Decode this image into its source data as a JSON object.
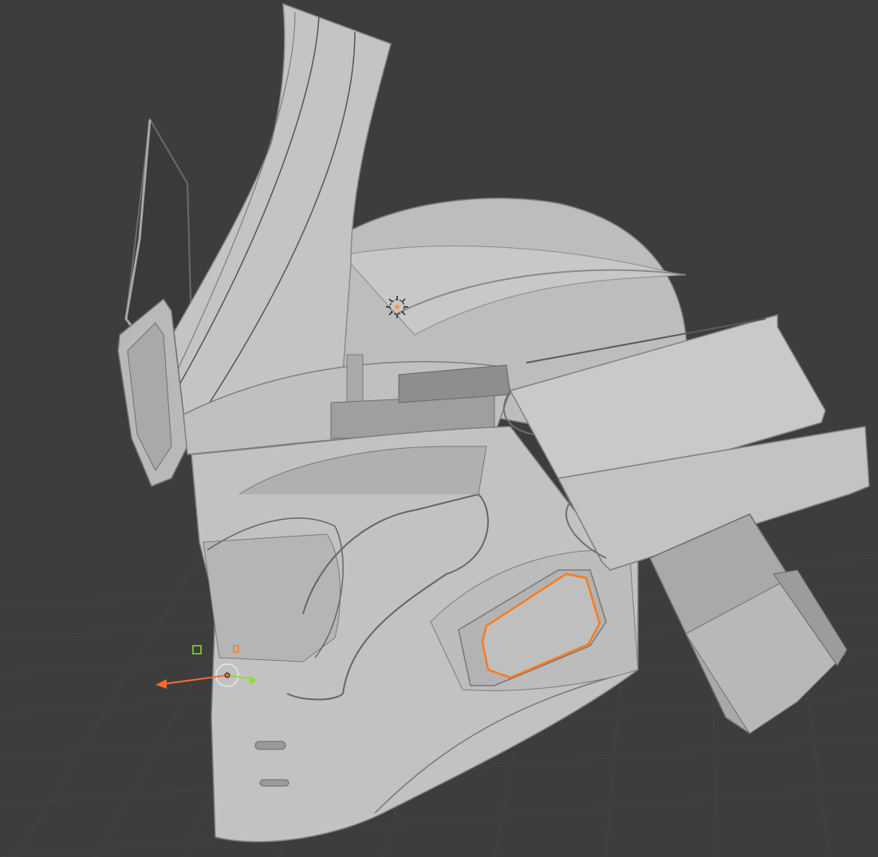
{
  "viewport": {
    "view": "3d-viewport",
    "background": "#3d3d3d",
    "grid_color": "#444444",
    "model_color": "#bfbfbf",
    "shadow_color": "#8e8e8e",
    "edge_color": "#5a5a5a",
    "selection_color": "#ff7a1a",
    "gizmo_x_color": "#ff6b2b",
    "gizmo_y_color": "#8bdd3a",
    "light_color": "#e8e8e8"
  },
  "model": {
    "object": "helmet-mesh",
    "selected_part": "cheek-vent-panel"
  },
  "icons": {
    "light": "sun-lamp-icon",
    "cursor": "3d-cursor-icon",
    "gizmo": "transform-gizmo-icon"
  }
}
